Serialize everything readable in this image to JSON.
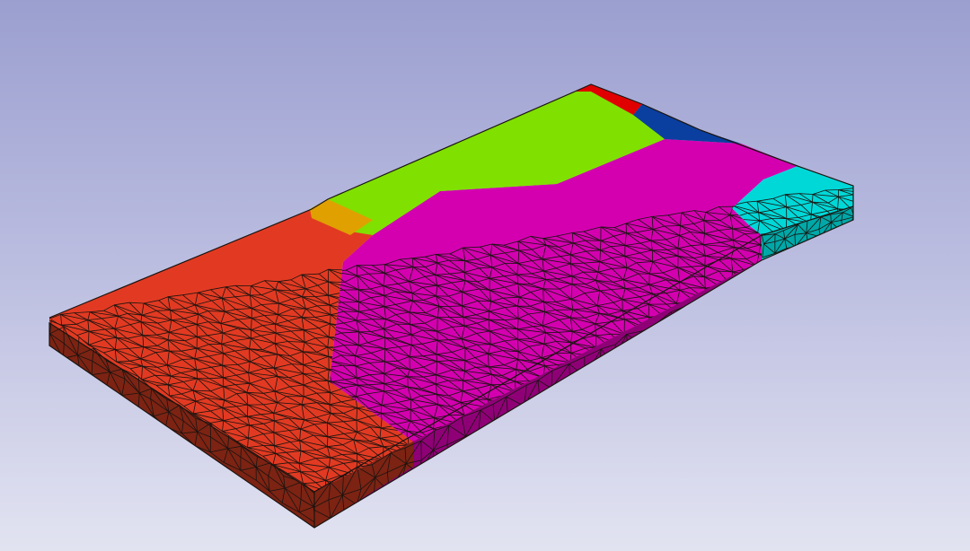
{
  "viewer": {
    "background_top": "#9b9fcf",
    "background_bottom": "#e2e3f1",
    "edge_color": "#1a1410"
  },
  "model": {
    "element_type": "tetrahedral-mesh",
    "regions": [
      {
        "id": "red-orange",
        "color": "#e23a22",
        "side_color": "#7c2313"
      },
      {
        "id": "magenta",
        "color": "#d400b0",
        "side_color": "#8f0077"
      },
      {
        "id": "lime",
        "color": "#80e000"
      },
      {
        "id": "red-small",
        "color": "#e00000"
      },
      {
        "id": "blue",
        "color": "#0a3fa0"
      },
      {
        "id": "cyan",
        "color": "#00d8d8",
        "side_color": "#00a8a8"
      },
      {
        "id": "orange",
        "color": "#e0a000"
      }
    ]
  }
}
